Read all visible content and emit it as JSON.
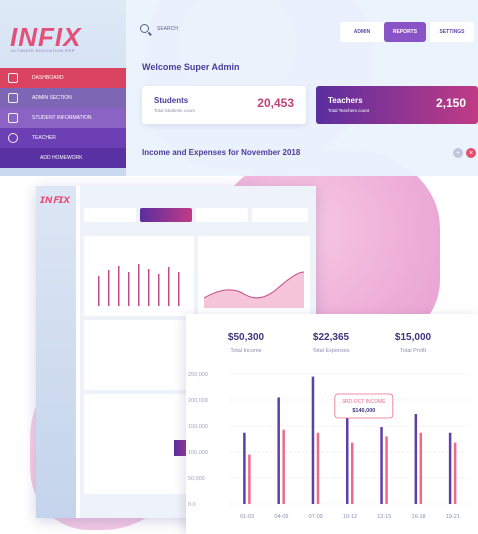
{
  "brand": {
    "logo": "INFIX",
    "tagline": "ULTIMATE EDUCATION ERP"
  },
  "search": {
    "placeholder": "SEARCH"
  },
  "top_buttons": {
    "admin": "ADMIN",
    "reports": "REPORTS",
    "settings": "SETTINGS"
  },
  "sidebar": {
    "items": [
      {
        "label": "DASHBOARD",
        "icon": "home-icon"
      },
      {
        "label": "ADMIN SECTION",
        "icon": "grid-icon"
      },
      {
        "label": "STUDENT INFORMATION",
        "icon": "document-icon"
      },
      {
        "label": "TEACHER",
        "icon": "user-icon"
      },
      {
        "label": "ADD HOMEWORK",
        "icon": ""
      }
    ]
  },
  "main": {
    "welcome": "Welcome Super Admin",
    "students": {
      "title": "Students",
      "subtitle": "Total Students count",
      "value": "20,453"
    },
    "teachers": {
      "title": "Teachers",
      "subtitle": "Total Teachers count",
      "value": "2,150"
    },
    "income_title": "Income and Expenses for November 2018"
  },
  "summary": {
    "income": {
      "value": "$50,300",
      "label": "Total Income"
    },
    "expenses": {
      "value": "$22,365",
      "label": "Total Expenses"
    },
    "profit": {
      "value": "$15,000",
      "label": "Total Profit"
    }
  },
  "tooltip": {
    "title": "3RD-OCT INCOME",
    "value": "$140,000"
  },
  "colors": {
    "purple": "#5d3fa8",
    "pink": "#ec6b8c",
    "accent": "#8b54c6",
    "brand_red": "#e3507a"
  },
  "chart_data": {
    "type": "bar",
    "categories": [
      "01-03",
      "04-09",
      "07-09",
      "10-12",
      "13-15",
      "16-18",
      "19-21"
    ],
    "series": [
      {
        "values": [
          137000,
          205000,
          245000,
          200000,
          148000,
          173000,
          137000
        ]
      },
      {
        "values": [
          95000,
          143000,
          137000,
          118000,
          130000,
          137000,
          118000
        ]
      }
    ],
    "ylim": [
      0,
      250000
    ],
    "yticks": [
      "0.0",
      "50,000",
      "100,000",
      "150,000",
      "200,000",
      "250,000"
    ],
    "grid": true
  }
}
